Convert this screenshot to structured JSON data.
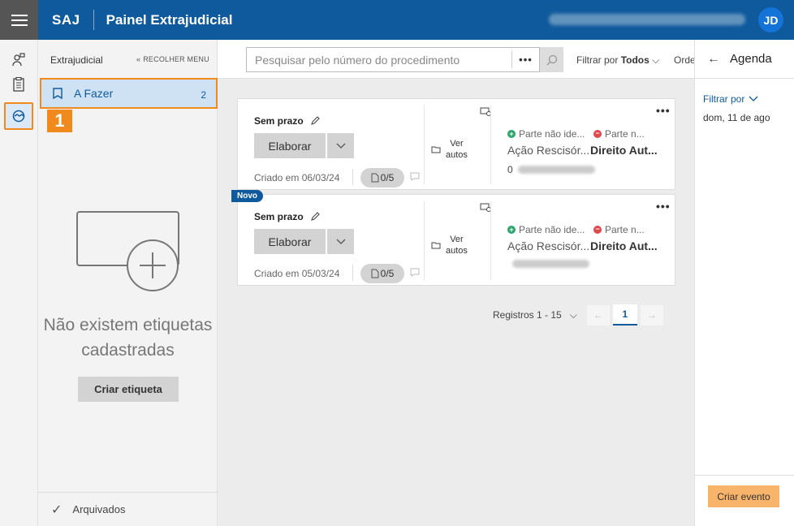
{
  "header": {
    "brand": "SAJ",
    "title": "Painel Extrajudicial",
    "user_initials": "JD"
  },
  "sidebar": {
    "heading": "Extrajudicial",
    "collapse_label": "RECOLHER MENU",
    "todo_label": "A Fazer",
    "todo_count": "2",
    "step_badge": "1",
    "empty_line1": "Não existem etiquetas",
    "empty_line2": "cadastradas",
    "create_tag_label": "Criar etiqueta",
    "archived_label": "Arquivados"
  },
  "search": {
    "placeholder": "Pesquisar pelo número do procedimento",
    "more": "•••"
  },
  "filters": {
    "filter_prefix": "Filtrar por",
    "filter_value": "Todos",
    "order_label": "Ordenar"
  },
  "cards": [
    {
      "deadline": "Sem prazo",
      "action_button": "Elaborar",
      "created": "Criado em 06/03/24",
      "docs": "0/5",
      "view_autos_line1": "Ver",
      "view_autos_line2": "autos",
      "party1": "Parte não ide...",
      "party2": "Parte n...",
      "action_name": "Ação Rescisór...",
      "action_area": "Direito Aut...",
      "proc_prefix": "0",
      "more": "•••"
    },
    {
      "badge": "Novo",
      "deadline": "Sem prazo",
      "action_button": "Elaborar",
      "created": "Criado em 05/03/24",
      "docs": "0/5",
      "view_autos_line1": "Ver",
      "view_autos_line2": "autos",
      "party1": "Parte não ide...",
      "party2": "Parte n...",
      "action_name": "Ação Rescisór...",
      "action_area": "Direito Aut...",
      "proc_prefix": "",
      "more": "•••"
    }
  ],
  "pagination": {
    "records": "Registros 1 - 15",
    "current_page": "1"
  },
  "agenda": {
    "title": "Agenda",
    "filter_label": "Filtrar por",
    "date": "dom, 11 de ago",
    "create_event_label": "Criar evento"
  },
  "colors": {
    "header": "#0f5a9c",
    "highlight": "#f08a1c",
    "selected_bg": "#cfe2f4",
    "create_event": "#f9b46b"
  }
}
